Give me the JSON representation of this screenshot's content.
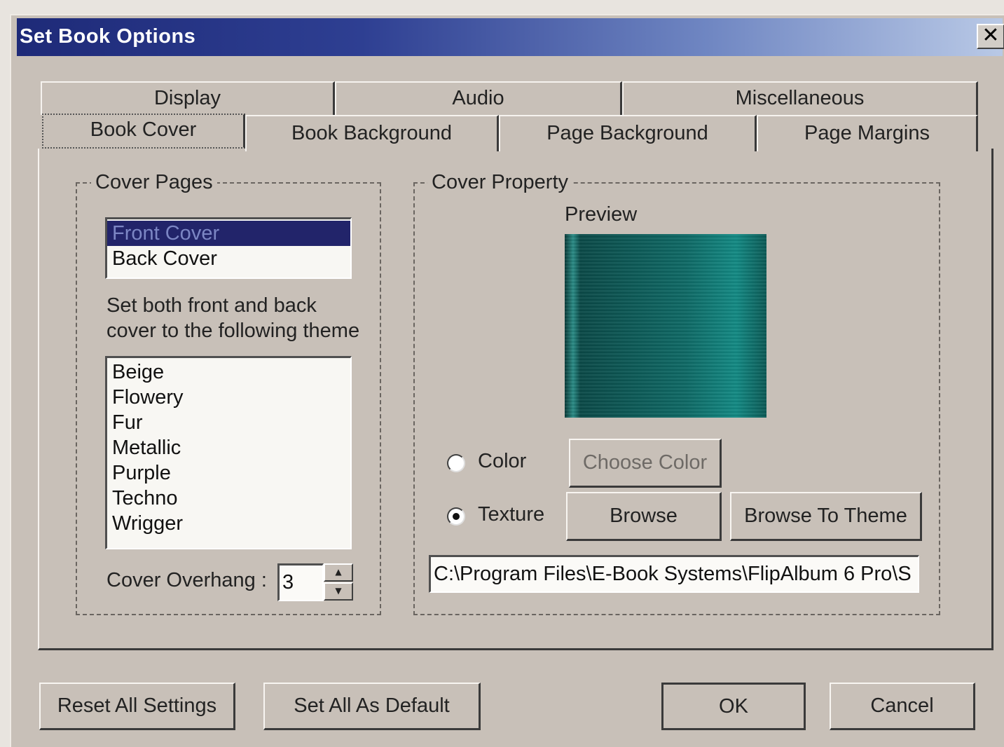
{
  "window": {
    "title": "Set Book Options",
    "close_glyph": "✕"
  },
  "tabs": {
    "row_top": [
      "Display",
      "Audio",
      "Miscellaneous"
    ],
    "row_bottom": [
      "Book Cover",
      "Book Background",
      "Page Background",
      "Page Margins"
    ],
    "active": "Book Cover"
  },
  "cover_pages": {
    "legend": "Cover Pages",
    "pages": [
      "Front Cover",
      "Back Cover"
    ],
    "selected": "Front Cover",
    "theme_hint_line1": "Set both front and back",
    "theme_hint_line2": "cover to the following theme",
    "themes": [
      "Beige",
      "Flowery",
      "Fur",
      "Metallic",
      "Purple",
      "Techno",
      "Wrigger"
    ],
    "overhang_label": "Cover Overhang :",
    "overhang_value": "3"
  },
  "cover_property": {
    "legend": "Cover Property",
    "preview_label": "Preview",
    "color_option": "Color",
    "texture_option": "Texture",
    "selected_option": "Texture",
    "choose_color_button": "Choose Color",
    "browse_button": "Browse",
    "browse_theme_button": "Browse To Theme",
    "path_value": "C:\\Program Files\\E-Book Systems\\FlipAlbum 6 Pro\\S"
  },
  "footer": {
    "reset_button": "Reset All Settings",
    "default_button": "Set All As Default",
    "ok_button": "OK",
    "cancel_button": "Cancel"
  },
  "colors": {
    "titlebar_start": "#1e2a78",
    "titlebar_end": "#b9c9e6",
    "dialog_face": "#c8c0b8",
    "selection": "#22246a",
    "preview_texture": "#138a84"
  }
}
